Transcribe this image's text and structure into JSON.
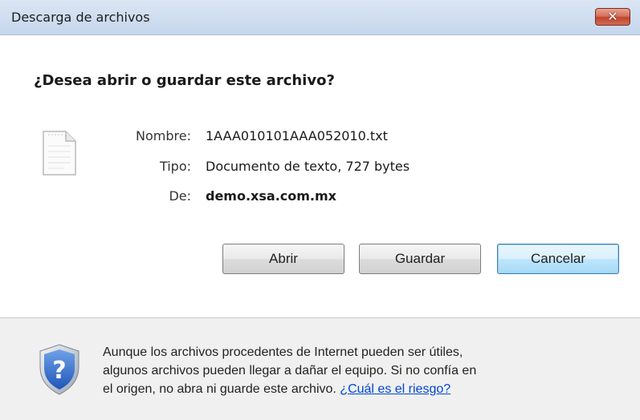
{
  "window": {
    "title": "Descarga de archivos",
    "close_label": "✕"
  },
  "prompt": {
    "question": "¿Desea abrir o guardar este archivo?"
  },
  "file": {
    "icon": "text-file-icon",
    "name_label": "Nombre:",
    "name_value": "1AAA010101AAA052010.txt",
    "type_label": "Tipo:",
    "type_value": "Documento de texto, 727 bytes",
    "from_label": "De:",
    "from_value": "demo.xsa.com.mx"
  },
  "buttons": {
    "open": "Abrir",
    "save": "Guardar",
    "cancel": "Cancelar"
  },
  "footer": {
    "icon": "security-shield-icon",
    "line1": "Aunque los archivos procedentes de Internet pueden ser útiles,",
    "line2": "algunos archivos pueden llegar a dañar el equipo. Si no confía en",
    "line3": "el origen, no abra ni guarde este archivo. ",
    "link": "¿Cuál es el riesgo?"
  },
  "colors": {
    "link": "#0046d5",
    "close_button": "#c0452d",
    "footer_bg": "#f0f0f0"
  }
}
